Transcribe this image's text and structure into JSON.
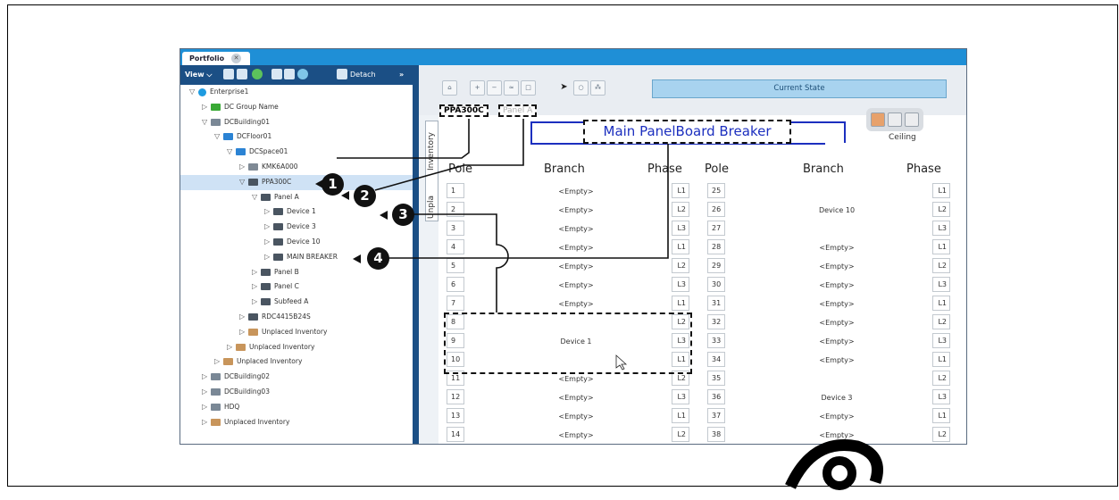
{
  "tab": {
    "label": "Portfolio",
    "close": "✕"
  },
  "toolbar": {
    "view_label": "View",
    "detach_label": "Detach",
    "more_label": "»"
  },
  "tree": [
    {
      "label": "Enterprise1",
      "level": 0,
      "tri": "▽",
      "icon": "globe-icon",
      "color": "#1e9be0"
    },
    {
      "label": "DC Group Name",
      "level": 1,
      "tri": "▷",
      "icon": "group-icon",
      "color": "#39a935"
    },
    {
      "label": "DCBuilding01",
      "level": 1,
      "tri": "▽",
      "icon": "building-icon",
      "color": "#7a8896"
    },
    {
      "label": "DCFloor01",
      "level": 2,
      "tri": "▽",
      "icon": "floor-icon",
      "color": "#2b83d4"
    },
    {
      "label": "DCSpace01",
      "level": 3,
      "tri": "▽",
      "icon": "space-icon",
      "color": "#2b83d4"
    },
    {
      "label": "KMK6A000",
      "level": 4,
      "tri": "▷",
      "icon": "rack-icon",
      "color": "#7f8a95"
    },
    {
      "label": "PPA300C",
      "level": 4,
      "tri": "▽",
      "icon": "panel-icon",
      "color": "#4a5561",
      "selected": true
    },
    {
      "label": "Panel A",
      "level": 5,
      "tri": "▽",
      "icon": "panel-icon",
      "color": "#4a5561"
    },
    {
      "label": "Device 1",
      "level": 6,
      "tri": "▷",
      "icon": "device-icon",
      "color": "#4a5561"
    },
    {
      "label": "Device 3",
      "level": 6,
      "tri": "▷",
      "icon": "device-icon",
      "color": "#4a5561"
    },
    {
      "label": "Device 10",
      "level": 6,
      "tri": "▷",
      "icon": "device-icon",
      "color": "#4a5561"
    },
    {
      "label": "MAIN BREAKER",
      "level": 6,
      "tri": "▷",
      "icon": "device-icon",
      "color": "#4a5561"
    },
    {
      "label": "Panel B",
      "level": 5,
      "tri": "▷",
      "icon": "panel-icon",
      "color": "#4a5561"
    },
    {
      "label": "Panel C",
      "level": 5,
      "tri": "▷",
      "icon": "panel-icon",
      "color": "#4a5561"
    },
    {
      "label": "Subfeed A",
      "level": 5,
      "tri": "▷",
      "icon": "panel-icon",
      "color": "#4a5561"
    },
    {
      "label": "RDC4415B24S",
      "level": 4,
      "tri": "▷",
      "icon": "panel-icon",
      "color": "#4a5561"
    },
    {
      "label": "Unplaced Inventory",
      "level": 4,
      "tri": "▷",
      "icon": "inventory-icon",
      "color": "#c8955b"
    },
    {
      "label": "Unplaced Inventory",
      "level": 3,
      "tri": "▷",
      "icon": "inventory-icon",
      "color": "#c8955b"
    },
    {
      "label": "Unplaced Inventory",
      "level": 2,
      "tri": "▷",
      "icon": "inventory-icon",
      "color": "#c8955b"
    },
    {
      "label": "DCBuilding02",
      "level": 1,
      "tri": "▷",
      "icon": "building-icon",
      "color": "#7a8896"
    },
    {
      "label": "DCBuilding03",
      "level": 1,
      "tri": "▷",
      "icon": "building-icon",
      "color": "#7a8896"
    },
    {
      "label": "HDQ",
      "level": 1,
      "tri": "▷",
      "icon": "building-icon",
      "color": "#7a8896"
    },
    {
      "label": "Unplaced Inventory",
      "level": 1,
      "tri": "▷",
      "icon": "inventory-icon",
      "color": "#c8955b"
    }
  ],
  "state_bar": "Current State",
  "side_tab": {
    "inventory": "Inventory",
    "unplaced": "Unpla"
  },
  "crumbs": {
    "first": "PPA300C",
    "second": "Panel A"
  },
  "main_title": "Main PanelBoard Breaker",
  "ceiling_label": "Ceiling",
  "headers": {
    "pole": "Pole",
    "branch": "Branch",
    "phase": "Phase",
    "pole_left": "Pole"
  },
  "left_rows": [
    {
      "pole": "1",
      "branch": "<Empty>",
      "phase": "L1"
    },
    {
      "pole": "2",
      "branch": "<Empty>",
      "phase": "L2"
    },
    {
      "pole": "3",
      "branch": "<Empty>",
      "phase": "L3"
    },
    {
      "pole": "4",
      "branch": "<Empty>",
      "phase": "L1"
    },
    {
      "pole": "5",
      "branch": "<Empty>",
      "phase": "L2"
    },
    {
      "pole": "6",
      "branch": "<Empty>",
      "phase": "L3"
    },
    {
      "pole": "7",
      "branch": "<Empty>",
      "phase": "L1"
    },
    {
      "pole": "8",
      "branch": "",
      "phase": "L2"
    },
    {
      "pole": "9",
      "branch": "Device 1",
      "phase": "L3"
    },
    {
      "pole": "10",
      "branch": "",
      "phase": "L1"
    },
    {
      "pole": "11",
      "branch": "<Empty>",
      "phase": "L2"
    },
    {
      "pole": "12",
      "branch": "<Empty>",
      "phase": "L3"
    },
    {
      "pole": "13",
      "branch": "<Empty>",
      "phase": "L1"
    },
    {
      "pole": "14",
      "branch": "<Empty>",
      "phase": "L2"
    }
  ],
  "right_rows": [
    {
      "pole": "25",
      "branch": "",
      "phase": "L1"
    },
    {
      "pole": "26",
      "branch": "Device 10",
      "phase": "L2"
    },
    {
      "pole": "27",
      "branch": "",
      "phase": "L3"
    },
    {
      "pole": "28",
      "branch": "<Empty>",
      "phase": "L1"
    },
    {
      "pole": "29",
      "branch": "<Empty>",
      "phase": "L2"
    },
    {
      "pole": "30",
      "branch": "<Empty>",
      "phase": "L3"
    },
    {
      "pole": "31",
      "branch": "<Empty>",
      "phase": "L1"
    },
    {
      "pole": "32",
      "branch": "<Empty>",
      "phase": "L2"
    },
    {
      "pole": "33",
      "branch": "<Empty>",
      "phase": "L3"
    },
    {
      "pole": "34",
      "branch": "<Empty>",
      "phase": "L1"
    },
    {
      "pole": "35",
      "branch": "",
      "phase": "L2"
    },
    {
      "pole": "36",
      "branch": "Device 3",
      "phase": "L3"
    },
    {
      "pole": "37",
      "branch": "<Empty>",
      "phase": "L1"
    },
    {
      "pole": "38",
      "branch": "<Empty>",
      "phase": "L2"
    }
  ],
  "callouts": [
    "1",
    "2",
    "3",
    "4"
  ]
}
